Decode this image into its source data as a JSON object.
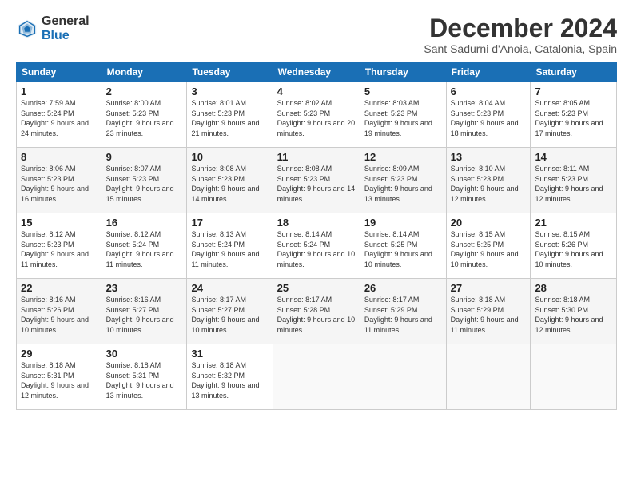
{
  "logo": {
    "text_general": "General",
    "text_blue": "Blue"
  },
  "title": "December 2024",
  "subtitle": "Sant Sadurni d'Anoia, Catalonia, Spain",
  "days_header": [
    "Sunday",
    "Monday",
    "Tuesday",
    "Wednesday",
    "Thursday",
    "Friday",
    "Saturday"
  ],
  "weeks": [
    [
      {
        "day": "1",
        "sunrise": "Sunrise: 7:59 AM",
        "sunset": "Sunset: 5:24 PM",
        "daylight": "Daylight: 9 hours and 24 minutes."
      },
      {
        "day": "2",
        "sunrise": "Sunrise: 8:00 AM",
        "sunset": "Sunset: 5:23 PM",
        "daylight": "Daylight: 9 hours and 23 minutes."
      },
      {
        "day": "3",
        "sunrise": "Sunrise: 8:01 AM",
        "sunset": "Sunset: 5:23 PM",
        "daylight": "Daylight: 9 hours and 21 minutes."
      },
      {
        "day": "4",
        "sunrise": "Sunrise: 8:02 AM",
        "sunset": "Sunset: 5:23 PM",
        "daylight": "Daylight: 9 hours and 20 minutes."
      },
      {
        "day": "5",
        "sunrise": "Sunrise: 8:03 AM",
        "sunset": "Sunset: 5:23 PM",
        "daylight": "Daylight: 9 hours and 19 minutes."
      },
      {
        "day": "6",
        "sunrise": "Sunrise: 8:04 AM",
        "sunset": "Sunset: 5:23 PM",
        "daylight": "Daylight: 9 hours and 18 minutes."
      },
      {
        "day": "7",
        "sunrise": "Sunrise: 8:05 AM",
        "sunset": "Sunset: 5:23 PM",
        "daylight": "Daylight: 9 hours and 17 minutes."
      }
    ],
    [
      {
        "day": "8",
        "sunrise": "Sunrise: 8:06 AM",
        "sunset": "Sunset: 5:23 PM",
        "daylight": "Daylight: 9 hours and 16 minutes."
      },
      {
        "day": "9",
        "sunrise": "Sunrise: 8:07 AM",
        "sunset": "Sunset: 5:23 PM",
        "daylight": "Daylight: 9 hours and 15 minutes."
      },
      {
        "day": "10",
        "sunrise": "Sunrise: 8:08 AM",
        "sunset": "Sunset: 5:23 PM",
        "daylight": "Daylight: 9 hours and 14 minutes."
      },
      {
        "day": "11",
        "sunrise": "Sunrise: 8:08 AM",
        "sunset": "Sunset: 5:23 PM",
        "daylight": "Daylight: 9 hours and 14 minutes."
      },
      {
        "day": "12",
        "sunrise": "Sunrise: 8:09 AM",
        "sunset": "Sunset: 5:23 PM",
        "daylight": "Daylight: 9 hours and 13 minutes."
      },
      {
        "day": "13",
        "sunrise": "Sunrise: 8:10 AM",
        "sunset": "Sunset: 5:23 PM",
        "daylight": "Daylight: 9 hours and 12 minutes."
      },
      {
        "day": "14",
        "sunrise": "Sunrise: 8:11 AM",
        "sunset": "Sunset: 5:23 PM",
        "daylight": "Daylight: 9 hours and 12 minutes."
      }
    ],
    [
      {
        "day": "15",
        "sunrise": "Sunrise: 8:12 AM",
        "sunset": "Sunset: 5:23 PM",
        "daylight": "Daylight: 9 hours and 11 minutes."
      },
      {
        "day": "16",
        "sunrise": "Sunrise: 8:12 AM",
        "sunset": "Sunset: 5:24 PM",
        "daylight": "Daylight: 9 hours and 11 minutes."
      },
      {
        "day": "17",
        "sunrise": "Sunrise: 8:13 AM",
        "sunset": "Sunset: 5:24 PM",
        "daylight": "Daylight: 9 hours and 11 minutes."
      },
      {
        "day": "18",
        "sunrise": "Sunrise: 8:14 AM",
        "sunset": "Sunset: 5:24 PM",
        "daylight": "Daylight: 9 hours and 10 minutes."
      },
      {
        "day": "19",
        "sunrise": "Sunrise: 8:14 AM",
        "sunset": "Sunset: 5:25 PM",
        "daylight": "Daylight: 9 hours and 10 minutes."
      },
      {
        "day": "20",
        "sunrise": "Sunrise: 8:15 AM",
        "sunset": "Sunset: 5:25 PM",
        "daylight": "Daylight: 9 hours and 10 minutes."
      },
      {
        "day": "21",
        "sunrise": "Sunrise: 8:15 AM",
        "sunset": "Sunset: 5:26 PM",
        "daylight": "Daylight: 9 hours and 10 minutes."
      }
    ],
    [
      {
        "day": "22",
        "sunrise": "Sunrise: 8:16 AM",
        "sunset": "Sunset: 5:26 PM",
        "daylight": "Daylight: 9 hours and 10 minutes."
      },
      {
        "day": "23",
        "sunrise": "Sunrise: 8:16 AM",
        "sunset": "Sunset: 5:27 PM",
        "daylight": "Daylight: 9 hours and 10 minutes."
      },
      {
        "day": "24",
        "sunrise": "Sunrise: 8:17 AM",
        "sunset": "Sunset: 5:27 PM",
        "daylight": "Daylight: 9 hours and 10 minutes."
      },
      {
        "day": "25",
        "sunrise": "Sunrise: 8:17 AM",
        "sunset": "Sunset: 5:28 PM",
        "daylight": "Daylight: 9 hours and 10 minutes."
      },
      {
        "day": "26",
        "sunrise": "Sunrise: 8:17 AM",
        "sunset": "Sunset: 5:29 PM",
        "daylight": "Daylight: 9 hours and 11 minutes."
      },
      {
        "day": "27",
        "sunrise": "Sunrise: 8:18 AM",
        "sunset": "Sunset: 5:29 PM",
        "daylight": "Daylight: 9 hours and 11 minutes."
      },
      {
        "day": "28",
        "sunrise": "Sunrise: 8:18 AM",
        "sunset": "Sunset: 5:30 PM",
        "daylight": "Daylight: 9 hours and 12 minutes."
      }
    ],
    [
      {
        "day": "29",
        "sunrise": "Sunrise: 8:18 AM",
        "sunset": "Sunset: 5:31 PM",
        "daylight": "Daylight: 9 hours and 12 minutes."
      },
      {
        "day": "30",
        "sunrise": "Sunrise: 8:18 AM",
        "sunset": "Sunset: 5:31 PM",
        "daylight": "Daylight: 9 hours and 13 minutes."
      },
      {
        "day": "31",
        "sunrise": "Sunrise: 8:18 AM",
        "sunset": "Sunset: 5:32 PM",
        "daylight": "Daylight: 9 hours and 13 minutes."
      },
      null,
      null,
      null,
      null
    ]
  ]
}
